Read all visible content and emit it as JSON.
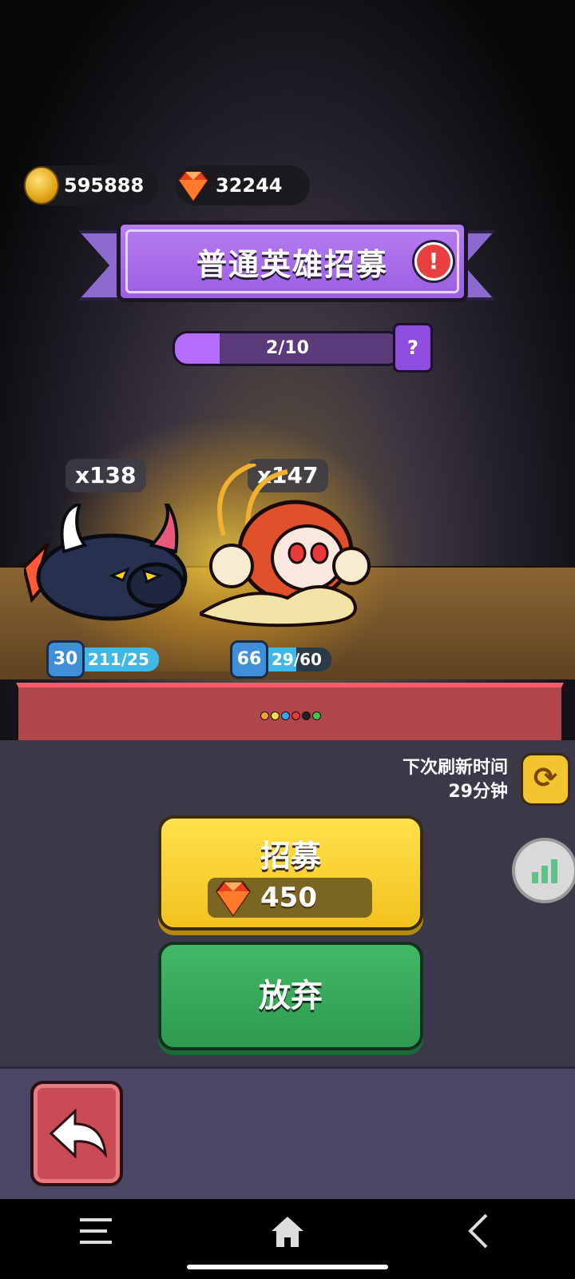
{
  "currency": {
    "coins": "595888",
    "gems": "32244"
  },
  "banner": {
    "title": "普通英雄招募",
    "alert": "!"
  },
  "progress": {
    "text": "2/10",
    "fraction": 0.2,
    "help": "?"
  },
  "heroes": [
    {
      "count": "x138",
      "level": "30",
      "hp": "211/25"
    },
    {
      "count": "x147",
      "level": "66",
      "hp": "29/60"
    }
  ],
  "dot_colors": [
    "#f2a12a",
    "#f2e14a",
    "#3aa0ff",
    "#e83a3a",
    "#222222",
    "#44c24a"
  ],
  "refresh": {
    "label": "下次刷新时间",
    "time": "29分钟"
  },
  "recruit": {
    "label": "招募",
    "cost": "450"
  },
  "giveup": {
    "label": "放弃"
  },
  "colors": {
    "recruit_button": "#f2c21f",
    "giveup_button": "#2e9a50",
    "back_button": "#c84b55",
    "banner": "#9a5ee3"
  }
}
